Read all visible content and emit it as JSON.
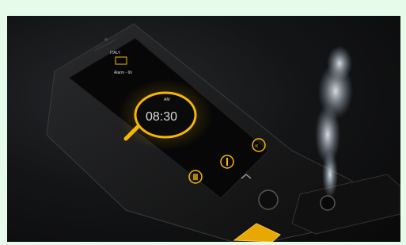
{
  "screen": {
    "time": "08:30",
    "am_pm": "AM",
    "header_small": "ITALY",
    "subtitle": "Alarm - 6h"
  },
  "colors": {
    "background": "#e6fbe9",
    "accent_glow": "#f5b800",
    "phone_body": "#141414"
  },
  "icons": [
    "alarm-icon",
    "light-icon",
    "chevron-icon",
    "settings-icon",
    "up-arrow-icon",
    "home-button-icon",
    "scent-cartridge-icon",
    "vapor-icon"
  ]
}
